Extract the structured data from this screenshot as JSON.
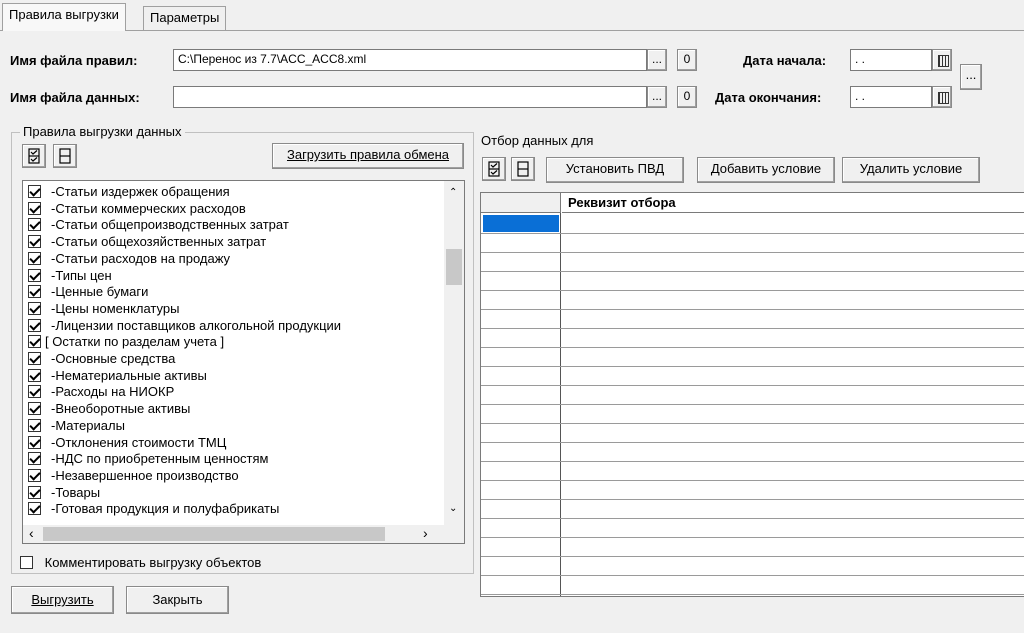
{
  "tabs": [
    {
      "label": "Правила выгрузки",
      "active": true
    },
    {
      "label": "Параметры",
      "active": false
    }
  ],
  "rules_file": {
    "label": "Имя файла правил:",
    "value": "C:\\Перенос из 7.7\\ACC_ACC8.xml",
    "browse_label": "...",
    "open_label": "0"
  },
  "data_file": {
    "label": "Имя файла данных:",
    "value": "",
    "browse_label": "...",
    "open_label": "0"
  },
  "date_start": {
    "label": "Дата начала:",
    "value": " .  ."
  },
  "date_end": {
    "label": "Дата окончания:",
    "value": " .  ."
  },
  "period_button_label": "...",
  "rules_group": {
    "title": "Правила выгрузки данных",
    "load_button": "Загрузить правила обмена",
    "items": [
      {
        "label": "-Статьи издержек обращения",
        "checked": true
      },
      {
        "label": "-Статьи коммерческих расходов",
        "checked": true
      },
      {
        "label": "-Статьи общепроизводственных затрат",
        "checked": true
      },
      {
        "label": "-Статьи общехозяйственных затрат",
        "checked": true
      },
      {
        "label": "-Статьи расходов на продажу",
        "checked": true
      },
      {
        "label": "-Типы цен",
        "checked": true
      },
      {
        "label": "-Ценные бумаги",
        "checked": true
      },
      {
        "label": "-Цены номенклатуры",
        "checked": true
      },
      {
        "label": "-Лицензии поставщиков алкогольной продукции",
        "checked": true
      },
      {
        "label": "[ Остатки по разделам учета ]",
        "checked": true
      },
      {
        "label": "-Основные средства",
        "checked": true
      },
      {
        "label": "-Нематериальные активы",
        "checked": true
      },
      {
        "label": "-Расходы на НИОКР",
        "checked": true
      },
      {
        "label": "-Внеоборотные активы",
        "checked": true
      },
      {
        "label": "-Материалы",
        "checked": true
      },
      {
        "label": "-Отклонения стоимости ТМЦ",
        "checked": true
      },
      {
        "label": "-НДС по приобретенным ценностям",
        "checked": true
      },
      {
        "label": "-Незавершенное производство",
        "checked": true
      },
      {
        "label": "-Товары",
        "checked": true
      },
      {
        "label": "-Готовая продукция и полуфабрикаты",
        "checked": true
      }
    ]
  },
  "comment_checkbox": {
    "label": "Комментировать выгрузку объектов",
    "checked": false
  },
  "filter": {
    "title": "Отбор данных для",
    "set_pvd": "Установить ПВД",
    "add_condition": "Добавить условие",
    "remove_condition": "Удалить условие",
    "column_header": "Реквизит отбора"
  },
  "export_button": "Выгрузить",
  "close_button": "Закрыть"
}
